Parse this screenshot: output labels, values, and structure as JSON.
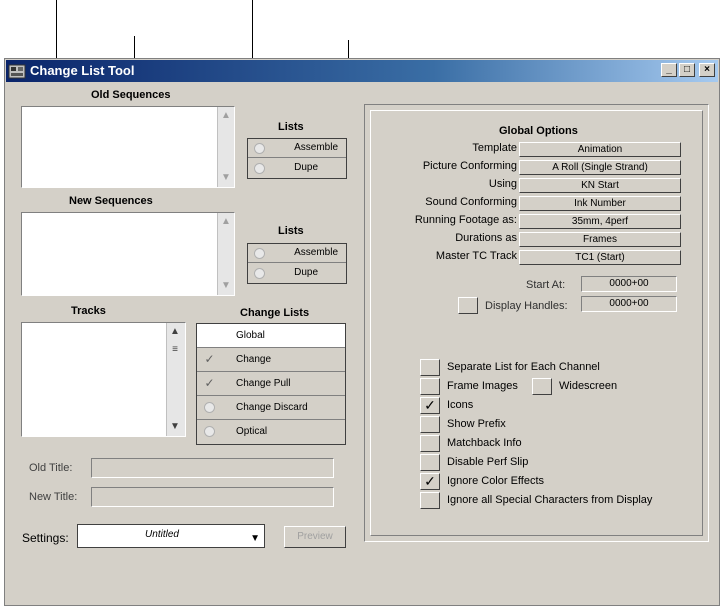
{
  "window": {
    "title": "Change List Tool",
    "controls": [
      "_",
      "□",
      "×"
    ]
  },
  "old_sequences": {
    "label": "Old Sequences"
  },
  "new_sequences": {
    "label": "New Sequences"
  },
  "lists_old": {
    "label": "Lists",
    "options": [
      "Assemble",
      "Dupe"
    ]
  },
  "lists_new": {
    "label": "Lists",
    "options": [
      "Assemble",
      "Dupe"
    ]
  },
  "tracks": {
    "label": "Tracks"
  },
  "change_lists": {
    "label": "Change Lists",
    "items": [
      {
        "label": "Global",
        "checked": false,
        "icon": "none"
      },
      {
        "label": "Change",
        "checked": true,
        "icon": "checkmark-icon"
      },
      {
        "label": "Change Pull",
        "checked": true,
        "icon": "checkmark-icon"
      },
      {
        "label": "Change Discard",
        "checked": false,
        "icon": "radio-icon"
      },
      {
        "label": "Optical",
        "checked": false,
        "icon": "radio-icon"
      }
    ]
  },
  "old_title": {
    "label": "Old Title:",
    "value": ""
  },
  "new_title": {
    "label": "New Title:",
    "value": ""
  },
  "settings": {
    "label": "Settings:",
    "value": "Untitled"
  },
  "preview_button": {
    "label": "Preview"
  },
  "global_options": {
    "title": "Global Options",
    "rows": [
      {
        "label": "Template",
        "value": "Animation"
      },
      {
        "label": "Picture Conforming",
        "value": "A Roll (Single Strand)"
      },
      {
        "label": "Using",
        "value": "KN Start"
      },
      {
        "label": "Sound Conforming",
        "value": "Ink Number"
      },
      {
        "label": "Running Footage as:",
        "value": "35mm, 4perf"
      },
      {
        "label": "Durations as",
        "value": "Frames"
      },
      {
        "label": "Master TC Track",
        "value": "TC1 (Start)"
      }
    ],
    "start_at": {
      "label": "Start At:",
      "value": "0000+00"
    },
    "display_handles": {
      "label": "Display Handles:",
      "value": "0000+00"
    },
    "checkboxes": [
      {
        "label": "Separate List for Each Channel",
        "checked": false
      },
      {
        "label": "Frame Images",
        "checked": false
      },
      {
        "label": "Icons",
        "checked": true
      },
      {
        "label": "Show Prefix",
        "checked": false
      },
      {
        "label": "Matchback Info",
        "checked": false
      },
      {
        "label": "Disable Perf Slip",
        "checked": false
      },
      {
        "label": "Ignore Color Effects",
        "checked": true
      },
      {
        "label": "Ignore all Special Characters from Display",
        "checked": false
      }
    ],
    "widescreen": {
      "label": "Widescreen",
      "checked": false
    },
    "check_glyph": "✓"
  }
}
